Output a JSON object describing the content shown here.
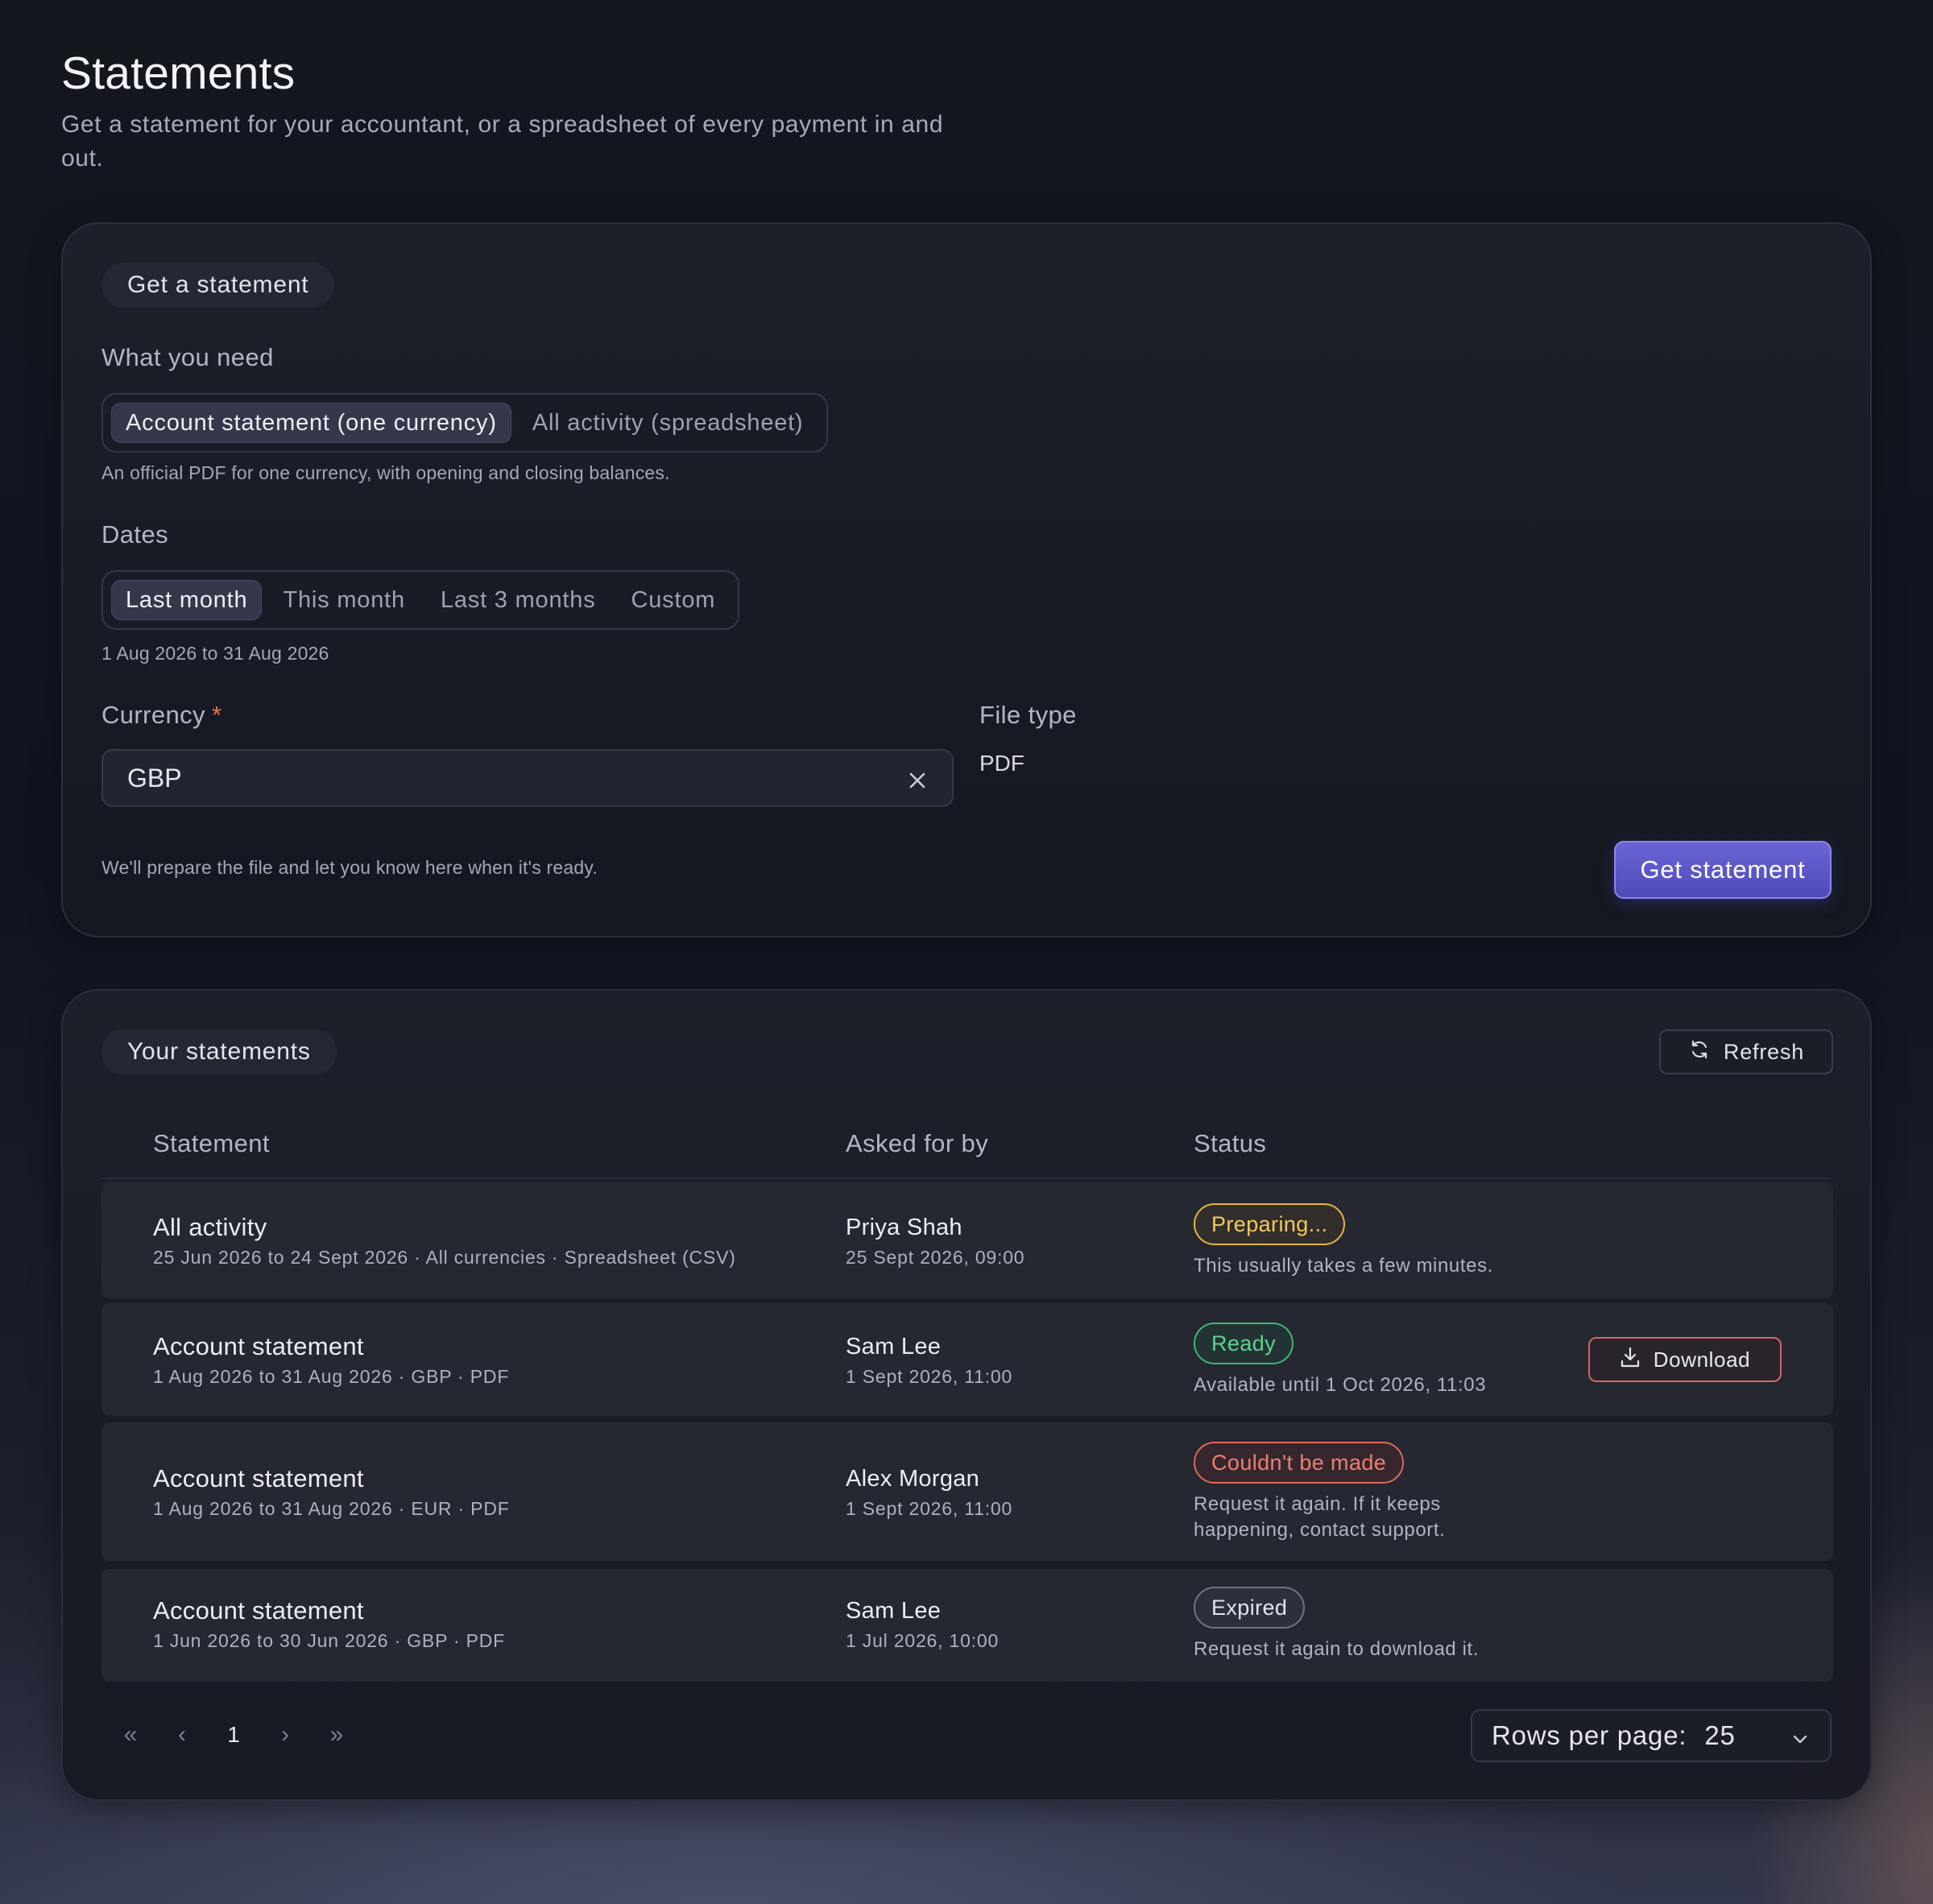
{
  "page": {
    "title": "Statements",
    "subtitle": "Get a statement for your accountant, or a spreadsheet of every payment in and out."
  },
  "request": {
    "chip": "Get a statement",
    "what_label": "What you need",
    "what_options": [
      "Account statement (one currency)",
      "All activity (spreadsheet)"
    ],
    "what_selected": "Account statement (one currency)",
    "what_hint": "An official PDF for one currency, with opening and closing balances.",
    "dates_label": "Dates",
    "date_options": [
      "Last month",
      "This month",
      "Last 3 months",
      "Custom"
    ],
    "date_selected": "Last month",
    "date_range": "1 Aug 2026 to 31 Aug 2026",
    "currency_label": "Currency",
    "required_mark": "*",
    "currency_value": "GBP",
    "filetype_label": "File type",
    "filetype_value": "PDF",
    "footer_note": "We'll prepare the file and let you know here when it's ready.",
    "submit_label": "Get statement"
  },
  "list": {
    "chip": "Your statements",
    "refresh_label": "Refresh",
    "columns": {
      "statement": "Statement",
      "asked_by": "Asked for by",
      "status": "Status"
    },
    "rows": [
      {
        "title": "All activity",
        "sub": "25 Jun 2026 to 24 Sept 2026 · All currencies · Spreadsheet (CSV)",
        "name": "Priya Shah",
        "date": "25 Sept 2026, 09:00",
        "status": "Preparing...",
        "note": "This usually takes a few minutes."
      },
      {
        "title": "Account statement",
        "sub": "1 Aug 2026 to 31 Aug 2026 · GBP · PDF",
        "name": "Sam Lee",
        "date": "1 Sept 2026, 11:00",
        "status": "Ready",
        "note": "Available until 1 Oct 2026, 11:03",
        "action": "Download"
      },
      {
        "title": "Account statement",
        "sub": "1 Aug 2026 to 31 Aug 2026 · EUR · PDF",
        "name": "Alex Morgan",
        "date": "1 Sept 2026, 11:00",
        "status": "Couldn't be made",
        "note": "Request it again. If it keeps happening, contact support."
      },
      {
        "title": "Account statement",
        "sub": "1 Jun 2026 to 30 Jun 2026 · GBP · PDF",
        "name": "Sam Lee",
        "date": "1 Jul 2026, 10:00",
        "status": "Expired",
        "note": "Request it again to download it."
      }
    ],
    "pagination": {
      "first": "«",
      "prev": "‹",
      "current": "1",
      "next": "›",
      "last": "»",
      "rows_per_page_label": "Rows per page:",
      "rows_per_page_value": "25"
    }
  },
  "colors": {
    "accent": "#5a54c8",
    "preparing": "#f3c95a",
    "ready": "#5fd28f",
    "failed": "#f07e72",
    "expired": "#e2e4ea"
  },
  "icons": {
    "clear": "close-icon",
    "refresh": "refresh-icon",
    "download": "download-icon",
    "dropdown": "chevron-down-icon"
  }
}
